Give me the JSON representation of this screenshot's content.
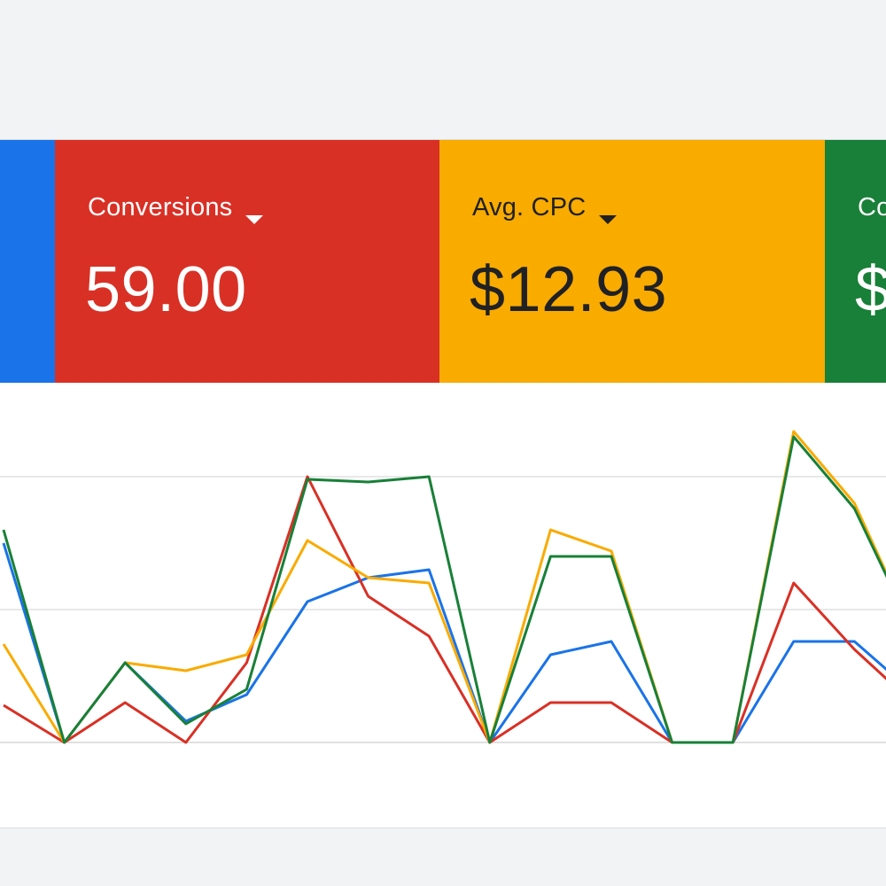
{
  "colors": {
    "blue": "#1a73e8",
    "red": "#d93025",
    "yellow": "#f9ab00",
    "green": "#188038",
    "card_text_light": "#ffffff",
    "card_text_dark": "#202124"
  },
  "scorecards": [
    {
      "id": "clicks",
      "name": "",
      "value": "",
      "color": "#1a73e8",
      "text_color": "#ffffff"
    },
    {
      "id": "conversions",
      "name": "Conversions",
      "value": "59.00",
      "color": "#d93025",
      "text_color": "#ffffff",
      "icon": "caret-down-icon"
    },
    {
      "id": "avg-cpc",
      "name": "Avg. CPC",
      "value": "$12.93",
      "color": "#f9ab00",
      "text_color": "#202124",
      "icon": "caret-down-icon"
    },
    {
      "id": "cost",
      "name": "Co",
      "value": "$",
      "color": "#188038",
      "text_color": "#ffffff"
    }
  ],
  "chart_data": {
    "type": "line",
    "x": [
      0,
      1,
      2,
      3,
      4,
      5,
      6,
      7,
      8,
      9,
      10,
      11,
      12,
      13,
      14,
      15
    ],
    "series": [
      {
        "color": "#1a73e8",
        "values": [
          0.75,
          0,
          0.3,
          0.08,
          0.18,
          0.53,
          0.62,
          0.65,
          0,
          0.33,
          0.38,
          0,
          0,
          0.38,
          0.38,
          0.18
        ]
      },
      {
        "color": "#d93025",
        "values": [
          0.14,
          0,
          0.15,
          0,
          0.3,
          1.0,
          0.55,
          0.4,
          0,
          0.15,
          0.15,
          0,
          0,
          0.6,
          0.35,
          0.14
        ]
      },
      {
        "color": "#f9ab00",
        "values": [
          0.37,
          0,
          0.3,
          0.27,
          0.33,
          0.76,
          0.62,
          0.6,
          0,
          0.8,
          0.72,
          0,
          0,
          1.17,
          0.9,
          0.4
        ]
      },
      {
        "color": "#188038",
        "values": [
          0.8,
          0,
          0.3,
          0.07,
          0.2,
          0.99,
          0.98,
          1.0,
          0,
          0.7,
          0.7,
          0,
          0,
          1.15,
          0.88,
          0.4
        ]
      }
    ],
    "grid": true,
    "ylim": [
      0,
      1.2
    ]
  }
}
